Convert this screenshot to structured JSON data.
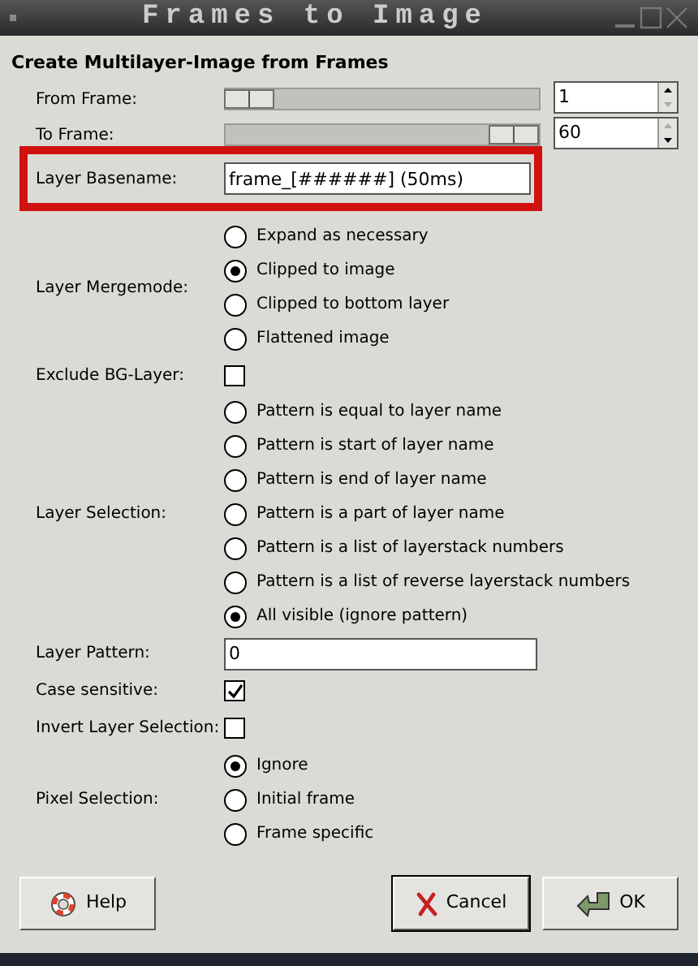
{
  "window": {
    "title": "Frames to Image"
  },
  "heading": "Create Multilayer-Image from Frames",
  "frame_range": [
    {
      "label": "From Frame:",
      "level": 0.08,
      "value": "1"
    },
    {
      "label": "To Frame:",
      "level": 0.92,
      "value": "60"
    }
  ],
  "basename": {
    "label": "Layer Basename:",
    "value": "frame_[######] (50ms)",
    "highlighted": true
  },
  "mergemode": {
    "label": "Layer Mergemode:",
    "options": [
      {
        "label": "Expand as necessary",
        "selected": false
      },
      {
        "label": "Clipped to image",
        "selected": true
      },
      {
        "label": "Clipped to bottom layer",
        "selected": false
      },
      {
        "label": "Flattened image",
        "selected": false
      }
    ]
  },
  "exclude_bg": {
    "label": "Exclude BG-Layer:",
    "checked": false
  },
  "layer_selection": {
    "label": "Layer Selection:",
    "options": [
      {
        "label": "Pattern is equal to layer name",
        "selected": false
      },
      {
        "label": "Pattern is start of layer name",
        "selected": false
      },
      {
        "label": "Pattern is end of layer name",
        "selected": false
      },
      {
        "label": "Pattern is a part of layer name",
        "selected": false
      },
      {
        "label": "Pattern is a list of layerstack numbers",
        "selected": false
      },
      {
        "label": "Pattern is a list of reverse layerstack numbers",
        "selected": false
      },
      {
        "label": "All visible (ignore pattern)",
        "selected": true
      }
    ]
  },
  "layer_pattern": {
    "label": "Layer Pattern:",
    "value": "0"
  },
  "case_sensitive": {
    "label": "Case sensitive:",
    "checked": true
  },
  "invert_selection": {
    "label": "Invert Layer Selection:",
    "checked": false
  },
  "pixel_selection": {
    "label": "Pixel Selection:",
    "options": [
      {
        "label": "Ignore",
        "selected": true
      },
      {
        "label": "Initial frame",
        "selected": false
      },
      {
        "label": "Frame specific",
        "selected": false
      }
    ]
  },
  "buttons": [
    {
      "label": "Help",
      "kind": "help"
    },
    {
      "label": "Cancel",
      "kind": "cancel"
    },
    {
      "label": "OK",
      "kind": "ok"
    }
  ]
}
